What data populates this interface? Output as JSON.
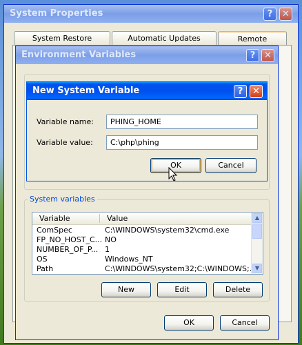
{
  "system_properties": {
    "title": "System Properties",
    "tabs": [
      "System Restore",
      "Automatic Updates",
      "Remote"
    ],
    "help_btn": "?",
    "close_btn": "✕"
  },
  "env_vars": {
    "title": "Environment Variables",
    "help_btn": "?",
    "close_btn": "✕",
    "system_group_label": "System variables",
    "columns": [
      "Variable",
      "Value"
    ],
    "rows": [
      {
        "variable": "ComSpec",
        "value": "C:\\WINDOWS\\system32\\cmd.exe"
      },
      {
        "variable": "FP_NO_HOST_C...",
        "value": "NO"
      },
      {
        "variable": "NUMBER_OF_P...",
        "value": "1"
      },
      {
        "variable": "OS",
        "value": "Windows_NT"
      },
      {
        "variable": "Path",
        "value": "C:\\WINDOWS\\system32;C:\\WINDOWS;..."
      }
    ],
    "buttons": {
      "new": "New",
      "edit": "Edit",
      "delete": "Delete",
      "ok": "OK",
      "cancel": "Cancel"
    }
  },
  "new_var": {
    "title": "New System Variable",
    "help_btn": "?",
    "close_btn": "✕",
    "name_label": "Variable name:",
    "name_value": "PHING_HOME",
    "value_label": "Variable value:",
    "value_value": "C:\\php\\phing",
    "ok": "OK",
    "cancel": "Cancel"
  }
}
